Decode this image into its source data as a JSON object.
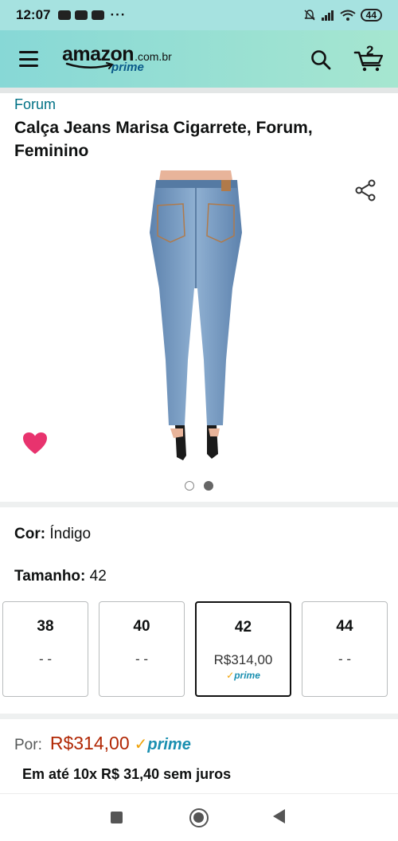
{
  "status_bar": {
    "time": "12:07",
    "more": "···",
    "battery": "44"
  },
  "header": {
    "logo_word": "amazon",
    "logo_tld": ".com.br",
    "logo_prime": "prime",
    "cart_count": "2",
    "icons": [
      "menu-icon",
      "search-icon",
      "cart-icon"
    ]
  },
  "product": {
    "brand": "Forum",
    "title": "Calça Jeans Marisa Cigarrete, Forum, Feminino",
    "image_count": 2,
    "active_image": 2
  },
  "options": {
    "color_label": "Cor:",
    "color_value": "Índigo",
    "size_label": "Tamanho:",
    "size_value": "42",
    "sizes": [
      {
        "size": "38",
        "price": "- -",
        "prime": ""
      },
      {
        "size": "40",
        "price": "- -",
        "prime": ""
      },
      {
        "size": "42",
        "price": "R$314,00",
        "prime": "prime"
      },
      {
        "size": "44",
        "price": "- -",
        "prime": ""
      }
    ]
  },
  "pricing": {
    "por_label": "Por:",
    "price": "R$314,00",
    "prime": "prime",
    "installments": "Em até 10x R$ 31,40 sem juros"
  },
  "colors": {
    "header_bg": "#87d8d6",
    "link": "#007185",
    "price": "#b12704",
    "prime_blue": "#1a8fb0",
    "prime_check": "#f0a30a",
    "wishlist": "#e8336e"
  }
}
